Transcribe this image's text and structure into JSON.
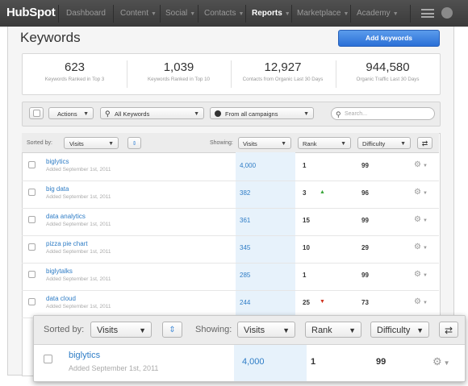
{
  "nav": {
    "logo": "HubSpot",
    "items": [
      {
        "label": "Dashboard",
        "caret": false,
        "active": false
      },
      {
        "label": "Content",
        "caret": true,
        "active": false
      },
      {
        "label": "Social",
        "caret": true,
        "active": false
      },
      {
        "label": "Contacts",
        "caret": true,
        "active": false
      },
      {
        "label": "Reports",
        "caret": true,
        "active": true
      },
      {
        "label": "Marketplace",
        "caret": true,
        "active": false
      },
      {
        "label": "Academy",
        "caret": true,
        "active": false
      }
    ],
    "caret_glyph": "▼"
  },
  "page": {
    "title": "Keywords",
    "add_button": "Add keywords"
  },
  "stats": [
    {
      "value": "623",
      "label": "Keywords Ranked in Top 3"
    },
    {
      "value": "1,039",
      "label": "Keywords Ranked in Top 10"
    },
    {
      "value": "12,927",
      "label": "Contacts from Organic Last 30 Days"
    },
    {
      "value": "944,580",
      "label": "Organic Traffic Last 30 Days"
    }
  ],
  "filters": {
    "actions": "Actions",
    "keyword_filter": "All Keywords",
    "campaign_filter": "From all campaigns",
    "search_placeholder": "Search..."
  },
  "table_header": {
    "sorted_by_label": "Sorted by:",
    "sorted_by_value": "Visits",
    "showing_label": "Showing:",
    "columns": [
      "Visits",
      "Rank",
      "Difficulty"
    ]
  },
  "rows": [
    {
      "keyword": "biglytics",
      "added": "Added September 1st, 2011",
      "visits": "4,000",
      "rank": "1",
      "trend": "",
      "difficulty": "99"
    },
    {
      "keyword": "big data",
      "added": "Added September 1st, 2011",
      "visits": "382",
      "rank": "3",
      "trend": "up",
      "difficulty": "96"
    },
    {
      "keyword": "data analytics",
      "added": "Added September 1st, 2011",
      "visits": "361",
      "rank": "15",
      "trend": "",
      "difficulty": "99"
    },
    {
      "keyword": "pizza pie chart",
      "added": "Added September 1st, 2011",
      "visits": "345",
      "rank": "10",
      "trend": "",
      "difficulty": "29"
    },
    {
      "keyword": "biglytalks",
      "added": "Added September 1st, 2011",
      "visits": "285",
      "rank": "1",
      "trend": "",
      "difficulty": "99"
    },
    {
      "keyword": "data cloud",
      "added": "Added September 1st, 2011",
      "visits": "244",
      "rank": "25",
      "trend": "down",
      "difficulty": "73"
    }
  ],
  "trend_glyphs": {
    "up": "▲",
    "down": "▼"
  },
  "trend_colors": {
    "up": "#3aa53a",
    "down": "#d0331f"
  },
  "zoom": {
    "sorted_by_label": "Sorted by:",
    "sorted_by_value": "Visits",
    "showing_label": "Showing:",
    "columns": [
      "Visits",
      "Rank",
      "Difficulty"
    ],
    "row": {
      "keyword": "biglytics",
      "added": "Added September 1st, 2011",
      "visits": "4,000",
      "rank": "1",
      "difficulty": "99"
    }
  },
  "colors": {
    "accent": "#2f7dc6",
    "nav_bg": "#454545",
    "button": "#3b82e0"
  }
}
